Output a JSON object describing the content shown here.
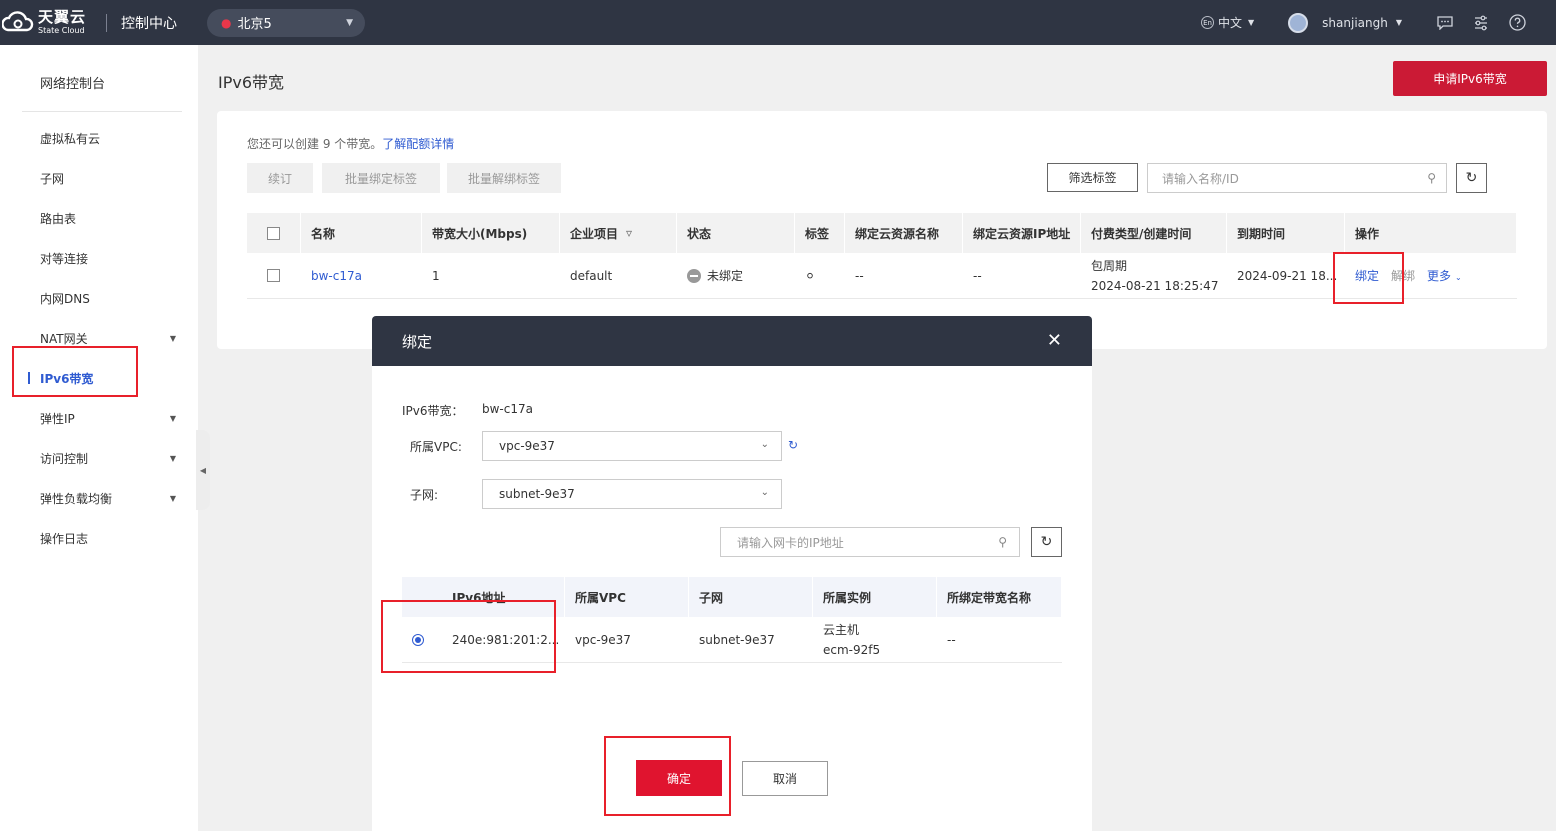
{
  "topnav": {
    "logo_cn": "天翼云",
    "logo_en": "State Cloud",
    "console_label": "控制中心",
    "region": "北京5",
    "language": "中文",
    "language_badge": "En",
    "username": "shanjiangh"
  },
  "sidebar": {
    "title": "网络控制台",
    "items": [
      {
        "label": "虚拟私有云"
      },
      {
        "label": "子网"
      },
      {
        "label": "路由表"
      },
      {
        "label": "对等连接"
      },
      {
        "label": "内网DNS"
      },
      {
        "label": "NAT网关"
      },
      {
        "label": "IPv6带宽"
      },
      {
        "label": "弹性IP"
      },
      {
        "label": "访问控制"
      },
      {
        "label": "弹性负载均衡"
      },
      {
        "label": "操作日志"
      }
    ]
  },
  "page": {
    "title": "IPv6带宽",
    "apply_button": "申请IPv6带宽",
    "quota_text": "您还可以创建 9 个带宽。",
    "quota_link": "了解配额详情",
    "toolbar": {
      "renew": "续订",
      "batch_bind_tag": "批量绑定标签",
      "batch_unbind_tag": "批量解绑标签",
      "filter_tag": "筛选标签",
      "search_placeholder": "请输入名称/ID"
    },
    "table": {
      "columns": [
        "名称",
        "带宽大小(Mbps)",
        "企业项目",
        "状态",
        "标签",
        "绑定云资源名称",
        "绑定云资源IP地址",
        "付费类型/创建时间",
        "到期时间",
        "操作"
      ],
      "rows": [
        {
          "name": "bw-c17a",
          "size": "1",
          "project": "default",
          "status": "未绑定",
          "resource_name": "--",
          "resource_ip": "--",
          "billing": "包周期",
          "created": "2024-08-21 18:25:47",
          "expire": "2024-09-21 18...",
          "op_bind": "绑定",
          "op_unbind": "解绑",
          "op_more": "更多"
        }
      ]
    }
  },
  "modal": {
    "title": "绑定",
    "bw_label": "IPv6带宽：",
    "bw_value": "bw-c17a",
    "vpc_label": "所属VPC:",
    "vpc_value": "vpc-9e37",
    "subnet_label": "子网:",
    "subnet_value": "subnet-9e37",
    "ip_search_placeholder": "请输入网卡的IP地址",
    "table": {
      "columns": [
        "IPv6地址",
        "所属VPC",
        "子网",
        "所属实例",
        "所绑定带宽名称"
      ],
      "rows": [
        {
          "ipv6": "240e:981:201:2...",
          "vpc": "vpc-9e37",
          "subnet": "subnet-9e37",
          "instance_type": "云主机",
          "instance_name": "ecm-92f5",
          "bound_bw": "--"
        }
      ]
    },
    "confirm": "确定",
    "cancel": "取消"
  },
  "colors": {
    "nav_bg": "#2f3543",
    "brand_red": "#cb1a35",
    "link_blue": "#2f5bd1",
    "highlight_red": "#e8202a"
  }
}
